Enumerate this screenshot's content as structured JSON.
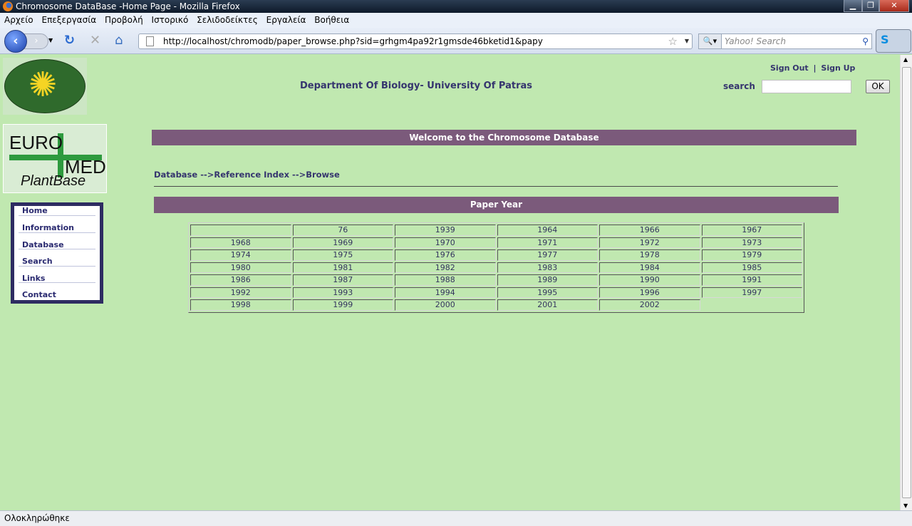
{
  "browser": {
    "title": "Chromosome DataBase -Home Page - Mozilla Firefox",
    "menu": [
      "Αρχείο",
      "Επεξεργασία",
      "Προβολή",
      "Ιστορικό",
      "Σελιδοδείκτες",
      "Εργαλεία",
      "Βοήθεια"
    ],
    "url": "http://localhost/chromodb/paper_browse.php?sid=grhgm4pa92r1gmsde46bketid1&papy",
    "search_placeholder": "Yahoo! Search",
    "status": "Ολοκληρώθηκε"
  },
  "header": {
    "title": "Department Of Biology- University Of Patras",
    "sign_out": "Sign Out",
    "separator": "|",
    "sign_up": "Sign Up",
    "search_label": "search",
    "search_value": "",
    "ok": "OK"
  },
  "logos": {
    "euromed_top": "EURO",
    "euromed_mid": "MED",
    "euromed_bottom": "PlantBase"
  },
  "nav": [
    "Home",
    "Information",
    "Database",
    "Search",
    "Links",
    "Contact"
  ],
  "main": {
    "welcome": "Welcome to the Chromosome Database",
    "breadcrumb": "Database -->Reference Index -->Browse",
    "section_title": "Paper Year",
    "years": [
      [
        "",
        "76",
        "1939",
        "1964",
        "1966",
        "1967"
      ],
      [
        "1968",
        "1969",
        "1970",
        "1971",
        "1972",
        "1973"
      ],
      [
        "1974",
        "1975",
        "1976",
        "1977",
        "1978",
        "1979"
      ],
      [
        "1980",
        "1981",
        "1982",
        "1983",
        "1984",
        "1985"
      ],
      [
        "1986",
        "1987",
        "1988",
        "1989",
        "1990",
        "1991"
      ],
      [
        "1992",
        "1993",
        "1994",
        "1995",
        "1996",
        "1997"
      ],
      [
        "1998",
        "1999",
        "2000",
        "2001",
        "2002",
        null
      ]
    ]
  }
}
